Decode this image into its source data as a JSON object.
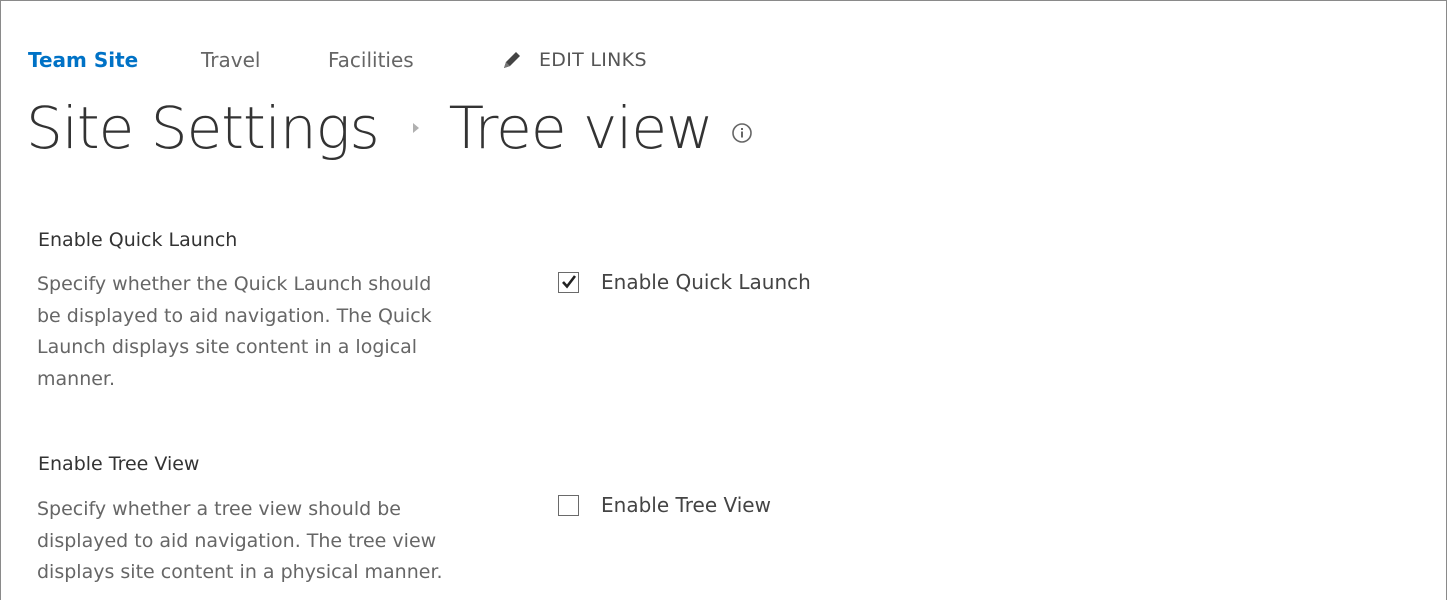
{
  "nav": {
    "items": [
      {
        "label": "Team Site",
        "selected": true
      },
      {
        "label": "Travel",
        "selected": false
      },
      {
        "label": "Facilities",
        "selected": false
      }
    ],
    "edit_links": {
      "icon": "pencil-icon",
      "label": "EDIT LINKS"
    }
  },
  "page_title": {
    "parent": "Site Settings",
    "current": "Tree view",
    "info_icon": "info-icon"
  },
  "sections": [
    {
      "title": "Enable Quick Launch",
      "description_lines": [
        "Specify whether the Quick Launch should",
        "be displayed to aid navigation.  The Quick",
        "Launch displays site content in a logical",
        "manner."
      ],
      "checkbox_label": "Enable Quick Launch",
      "checked": true
    },
    {
      "title": "Enable Tree View",
      "description_lines": [
        "Specify whether a tree view should be",
        "displayed to aid navigation.  The tree view",
        "displays site content in a physical manner."
      ],
      "checkbox_label": "Enable Tree View",
      "checked": false
    }
  ],
  "colors": {
    "link_selected": "#0072c6",
    "text": "#444444",
    "muted_text": "#666666"
  }
}
